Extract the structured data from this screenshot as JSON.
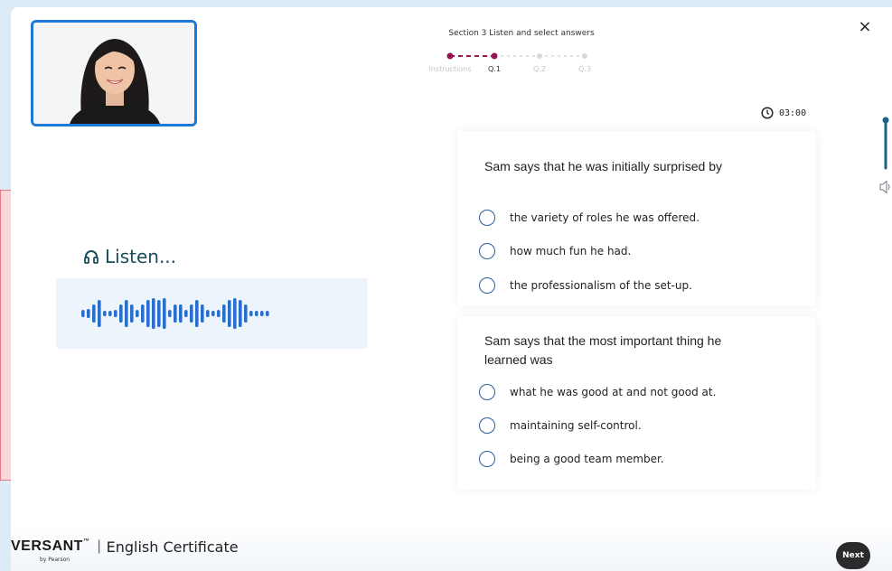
{
  "header": {
    "section_title": "Section 3  Listen and select answers",
    "steps": [
      "Instructions",
      "Q.1",
      "Q.2",
      "Q.3"
    ],
    "close_label": "×",
    "timer": "03:00"
  },
  "listen": {
    "label": "Listen..."
  },
  "questions": [
    {
      "text": "Sam says that he was initially surprised by",
      "options": [
        "the variety of roles he was offered.",
        "how much fun he had.",
        "the professionalism of the set-up."
      ]
    },
    {
      "text": "Sam says that the most important thing he learned was",
      "options": [
        "what he was good at and not good at.",
        "maintaining self-control.",
        "being a good team member."
      ]
    }
  ],
  "footer": {
    "brand": "VERSANT",
    "brand_tm": "™",
    "brand_sub": "by Pearson",
    "separator": "|",
    "product": "English Certificate",
    "next_label": "Next"
  },
  "colors": {
    "accent_blue": "#1f78d8",
    "progress_done": "#9a1350",
    "wave_bar": "#2a6fc9",
    "callout_fill": "#fbd8d8",
    "callout_stroke": "#e05a6a"
  }
}
